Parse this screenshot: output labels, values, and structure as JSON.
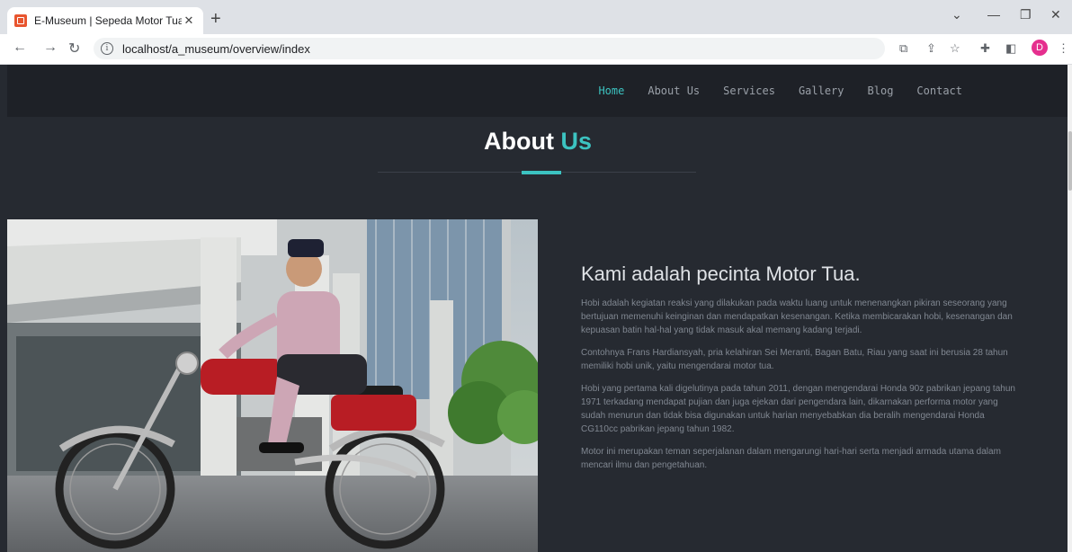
{
  "browser": {
    "tab_title": "E-Museum | Sepeda Motor Tua",
    "tab_close": "✕",
    "new_tab": "+",
    "url": "localhost/a_museum/overview/index",
    "profile_initial": "D"
  },
  "nav": {
    "items": [
      "Home",
      "About Us",
      "Services",
      "Gallery",
      "Blog",
      "Contact"
    ],
    "active": "Home",
    "accent_color": "#3cc3c1"
  },
  "section": {
    "title_main": "About",
    "title_accent": "Us"
  },
  "about": {
    "heading": "Kami adalah pecinta Motor Tua.",
    "paragraphs": [
      "Hobi adalah kegiatan reaksi yang dilakukan pada waktu luang untuk menenangkan pikiran seseorang yang bertujuan memenuhi keinginan dan mendapatkan kesenangan. Ketika membicarakan hobi, kesenangan dan kepuasan batin hal-hal yang tidak masuk akal memang kadang terjadi.",
      "Contohnya Frans Hardiansyah, pria kelahiran Sei Meranti, Bagan Batu, Riau yang saat ini berusia 28 tahun memiliki hobi unik, yaitu mengendarai motor tua.",
      "Hobi yang pertama kali digelutinya pada tahun 2011, dengan mengendarai Honda 90z pabrikan jepang tahun 1971 terkadang mendapat pujian dan juga ejekan dari pengendara lain, dikarnakan performa motor yang sudah menurun dan tidak bisa digunakan untuk harian menyebabkan dia beralih mengendarai Honda CG110cc pabrikan jepang tahun 1982.",
      "Motor ini merupakan teman seperjalanan dalam mengarungi hari-hari serta menjadi armada utama dalam mencari ilmu dan pengetahuan."
    ]
  }
}
